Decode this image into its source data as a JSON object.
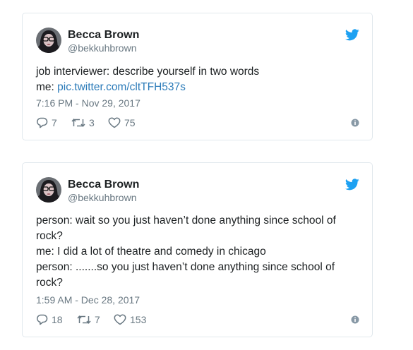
{
  "tweets": [
    {
      "author_name": "Becca Brown",
      "author_handle": "@bekkuhbrown",
      "text_lines": [
        "job interviewer: describe yourself in two words"
      ],
      "text_prefix": "me: ",
      "link_text": "pic.twitter.com/cltTFH537s",
      "timestamp": "7:16 PM - Nov 29, 2017",
      "replies": "7",
      "retweets": "3",
      "likes": "75"
    },
    {
      "author_name": "Becca Brown",
      "author_handle": "@bekkuhbrown",
      "text_lines": [
        "person: wait so you just haven’t done anything since school of rock?",
        "me: I did a lot of theatre and comedy in chicago",
        "person: .......so you just haven’t done anything since school of rock?"
      ],
      "timestamp": "1:59 AM - Dec 28, 2017",
      "replies": "18",
      "retweets": "7",
      "likes": "153"
    }
  ],
  "icons": {
    "brand": "twitter-bird-icon",
    "reply": "reply-icon",
    "retweet": "retweet-icon",
    "like": "heart-icon",
    "info": "info-icon"
  },
  "colors": {
    "brand_blue": "#1da1f2",
    "link": "#2b7bb9",
    "muted": "#697882",
    "border": "#e1e8ed",
    "text": "#1c2022"
  }
}
